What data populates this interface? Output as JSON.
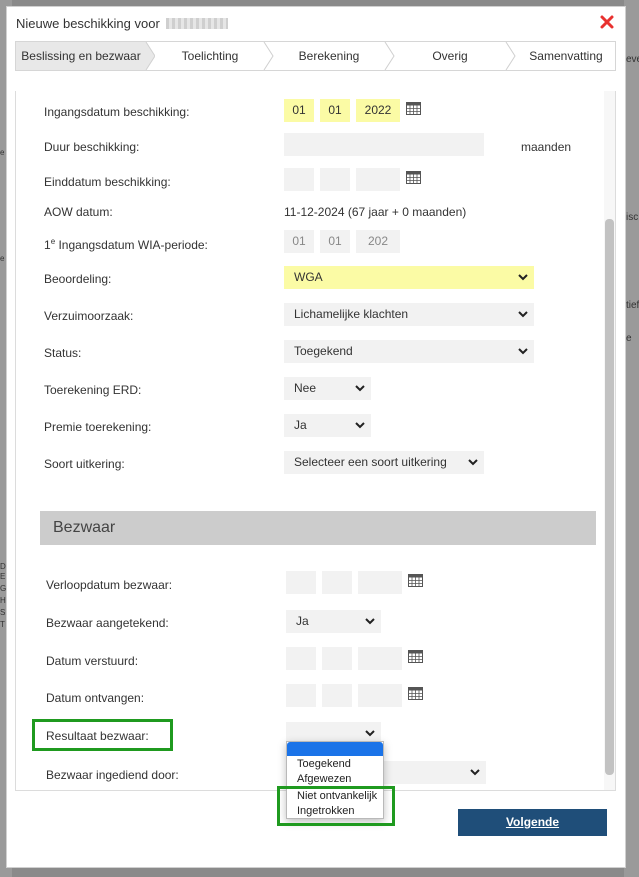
{
  "backdrop": {
    "right_snippets": [
      "eve",
      "isc",
      "tief",
      "e"
    ],
    "left_snippets": [
      "e",
      "e",
      "D",
      "E",
      "G",
      "H",
      "S",
      "T"
    ]
  },
  "dialog": {
    "title": "Nieuwe beschikking voor",
    "close_icon": "close-x-icon",
    "close_color": "#e8312f"
  },
  "steps": [
    "Beslissing en bezwaar",
    "Toelichting",
    "Berekening",
    "Overig",
    "Samenvatting"
  ],
  "form": {
    "ingangsdatum": {
      "label": "Ingangsdatum beschikking:",
      "day": "01",
      "month": "01",
      "year": "2022"
    },
    "duur": {
      "label": "Duur beschikking:",
      "unit": "maanden",
      "value": ""
    },
    "einddatum": {
      "label": "Einddatum beschikking:",
      "day": "",
      "month": "",
      "year": ""
    },
    "aow": {
      "label": "AOW datum:",
      "value": "11-12-2024 (67 jaar + 0 maanden)"
    },
    "wia": {
      "label_prefix": "1",
      "label_sup": "e",
      "label_rest": " Ingangsdatum WIA-periode:",
      "day": "01",
      "month": "01",
      "year": "202"
    },
    "beoordeling": {
      "label": "Beoordeling:",
      "value": "WGA"
    },
    "verzuimoorzaak": {
      "label": "Verzuimoorzaak:",
      "value": "Lichamelijke klachten"
    },
    "status": {
      "label": "Status:",
      "value": "Toegekend"
    },
    "erd": {
      "label": "Toerekening ERD:",
      "value": "Nee"
    },
    "premie": {
      "label": "Premie toerekening:",
      "value": "Ja"
    },
    "soort": {
      "label": "Soort uitkering:",
      "value": "Selecteer een soort uitkering"
    }
  },
  "bezwaar": {
    "header": "Bezwaar",
    "verloopdatum": {
      "label": "Verloopdatum bezwaar:"
    },
    "aangetekend": {
      "label": "Bezwaar aangetekend:",
      "value": "Ja"
    },
    "verstuurd": {
      "label": "Datum verstuurd:"
    },
    "ontvangen": {
      "label": "Datum ontvangen:"
    },
    "resultaat": {
      "label": "Resultaat bezwaar:",
      "value": "",
      "options": [
        "Toegekend",
        "Afgewezen",
        "Niet ontvankelijk",
        "Ingetrokken"
      ]
    },
    "ingediend": {
      "label": "Bezwaar ingediend door:",
      "value": ""
    }
  },
  "colors": {
    "highlight_yellow": "#fbfba5",
    "highlight_green": "#1f9a1f",
    "primary_button": "#1f4e79",
    "section_header": "#cccccc"
  },
  "footer": {
    "next_label": "Volgende"
  }
}
